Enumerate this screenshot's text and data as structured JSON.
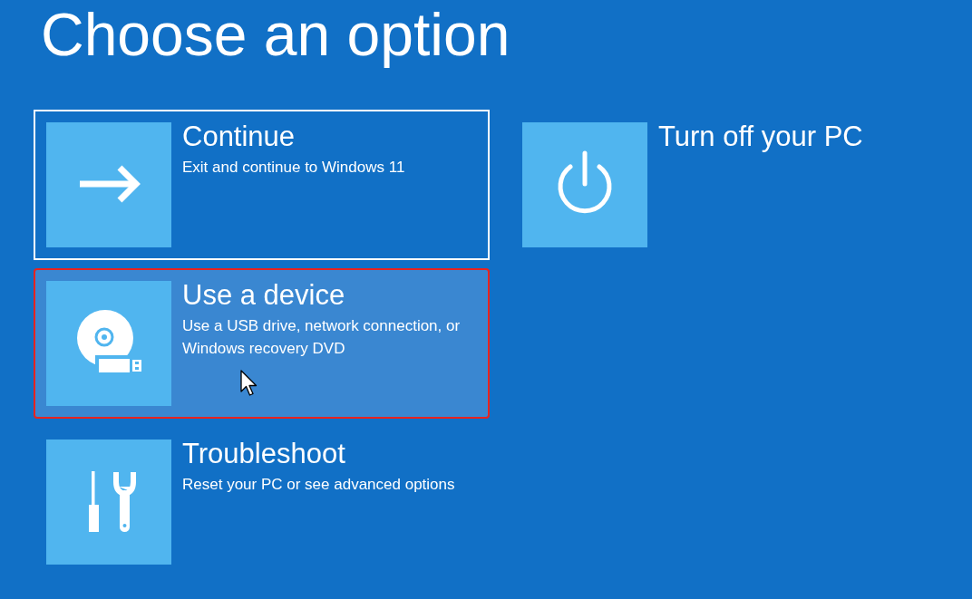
{
  "title": "Choose an option",
  "options": [
    {
      "kind": "continue",
      "title": "Continue",
      "description": "Exit and continue to Windows 11",
      "focused": true,
      "hovered": false,
      "highlighted": false
    },
    {
      "kind": "device",
      "title": "Use a device",
      "description": "Use a USB drive, network connection, or Windows recovery DVD",
      "focused": false,
      "hovered": true,
      "highlighted": true
    },
    {
      "kind": "troubleshoot",
      "title": "Troubleshoot",
      "description": "Reset your PC or see advanced options",
      "focused": false,
      "hovered": false,
      "highlighted": false
    },
    {
      "kind": "power",
      "title": "Turn off your PC",
      "focused": false,
      "hovered": false,
      "highlighted": false
    }
  ]
}
